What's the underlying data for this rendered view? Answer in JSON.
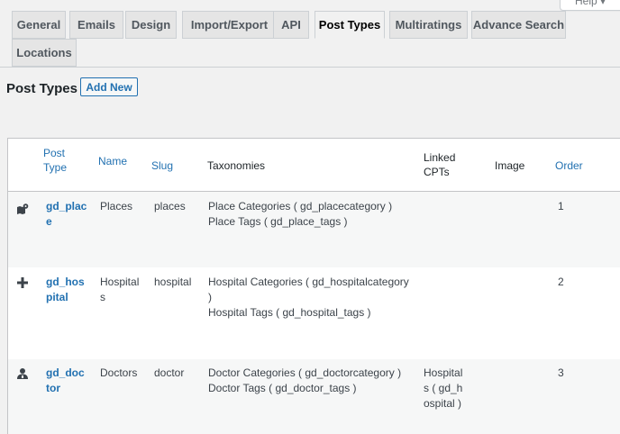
{
  "help": {
    "label": "Help ▾"
  },
  "tabs": [
    {
      "label": "General"
    },
    {
      "label": "Emails"
    },
    {
      "label": "Design"
    },
    {
      "label": "Import/Export"
    },
    {
      "label": "API"
    },
    {
      "label": "Post Types"
    },
    {
      "label": "Multiratings"
    },
    {
      "label": "Advance Search"
    },
    {
      "label": "Locations"
    }
  ],
  "page": {
    "title": "Post Types",
    "add_new": "Add New"
  },
  "table": {
    "headers": {
      "post_type": "Post Type",
      "name": "Name",
      "slug": "Slug",
      "taxonomies": "Taxonomies",
      "linked": "Linked CPTs",
      "image": "Image",
      "order": "Order"
    },
    "rows": [
      {
        "icon": "map-marker-icon",
        "post_type": "gd_place",
        "name": "Places",
        "slug": "places",
        "taxonomies": [
          "Place Categories ( gd_placecategory )",
          "Place Tags ( gd_place_tags )"
        ],
        "linked": "",
        "order": "1"
      },
      {
        "icon": "plus-icon",
        "post_type": "gd_hospital",
        "name": "Hospitals",
        "slug": "hospital",
        "taxonomies": [
          "Hospital Categories ( gd_hospitalcategory )",
          "Hospital Tags ( gd_hospital_tags )"
        ],
        "linked": "",
        "order": "2"
      },
      {
        "icon": "user-doctor-icon",
        "post_type": "gd_doctor",
        "name": "Doctors",
        "slug": "doctor",
        "taxonomies": [
          "Doctor Categories ( gd_doctorcategory )",
          "Doctor Tags ( gd_doctor_tags )"
        ],
        "linked": "Hospitals ( gd_hospital )",
        "order": "3"
      }
    ]
  }
}
